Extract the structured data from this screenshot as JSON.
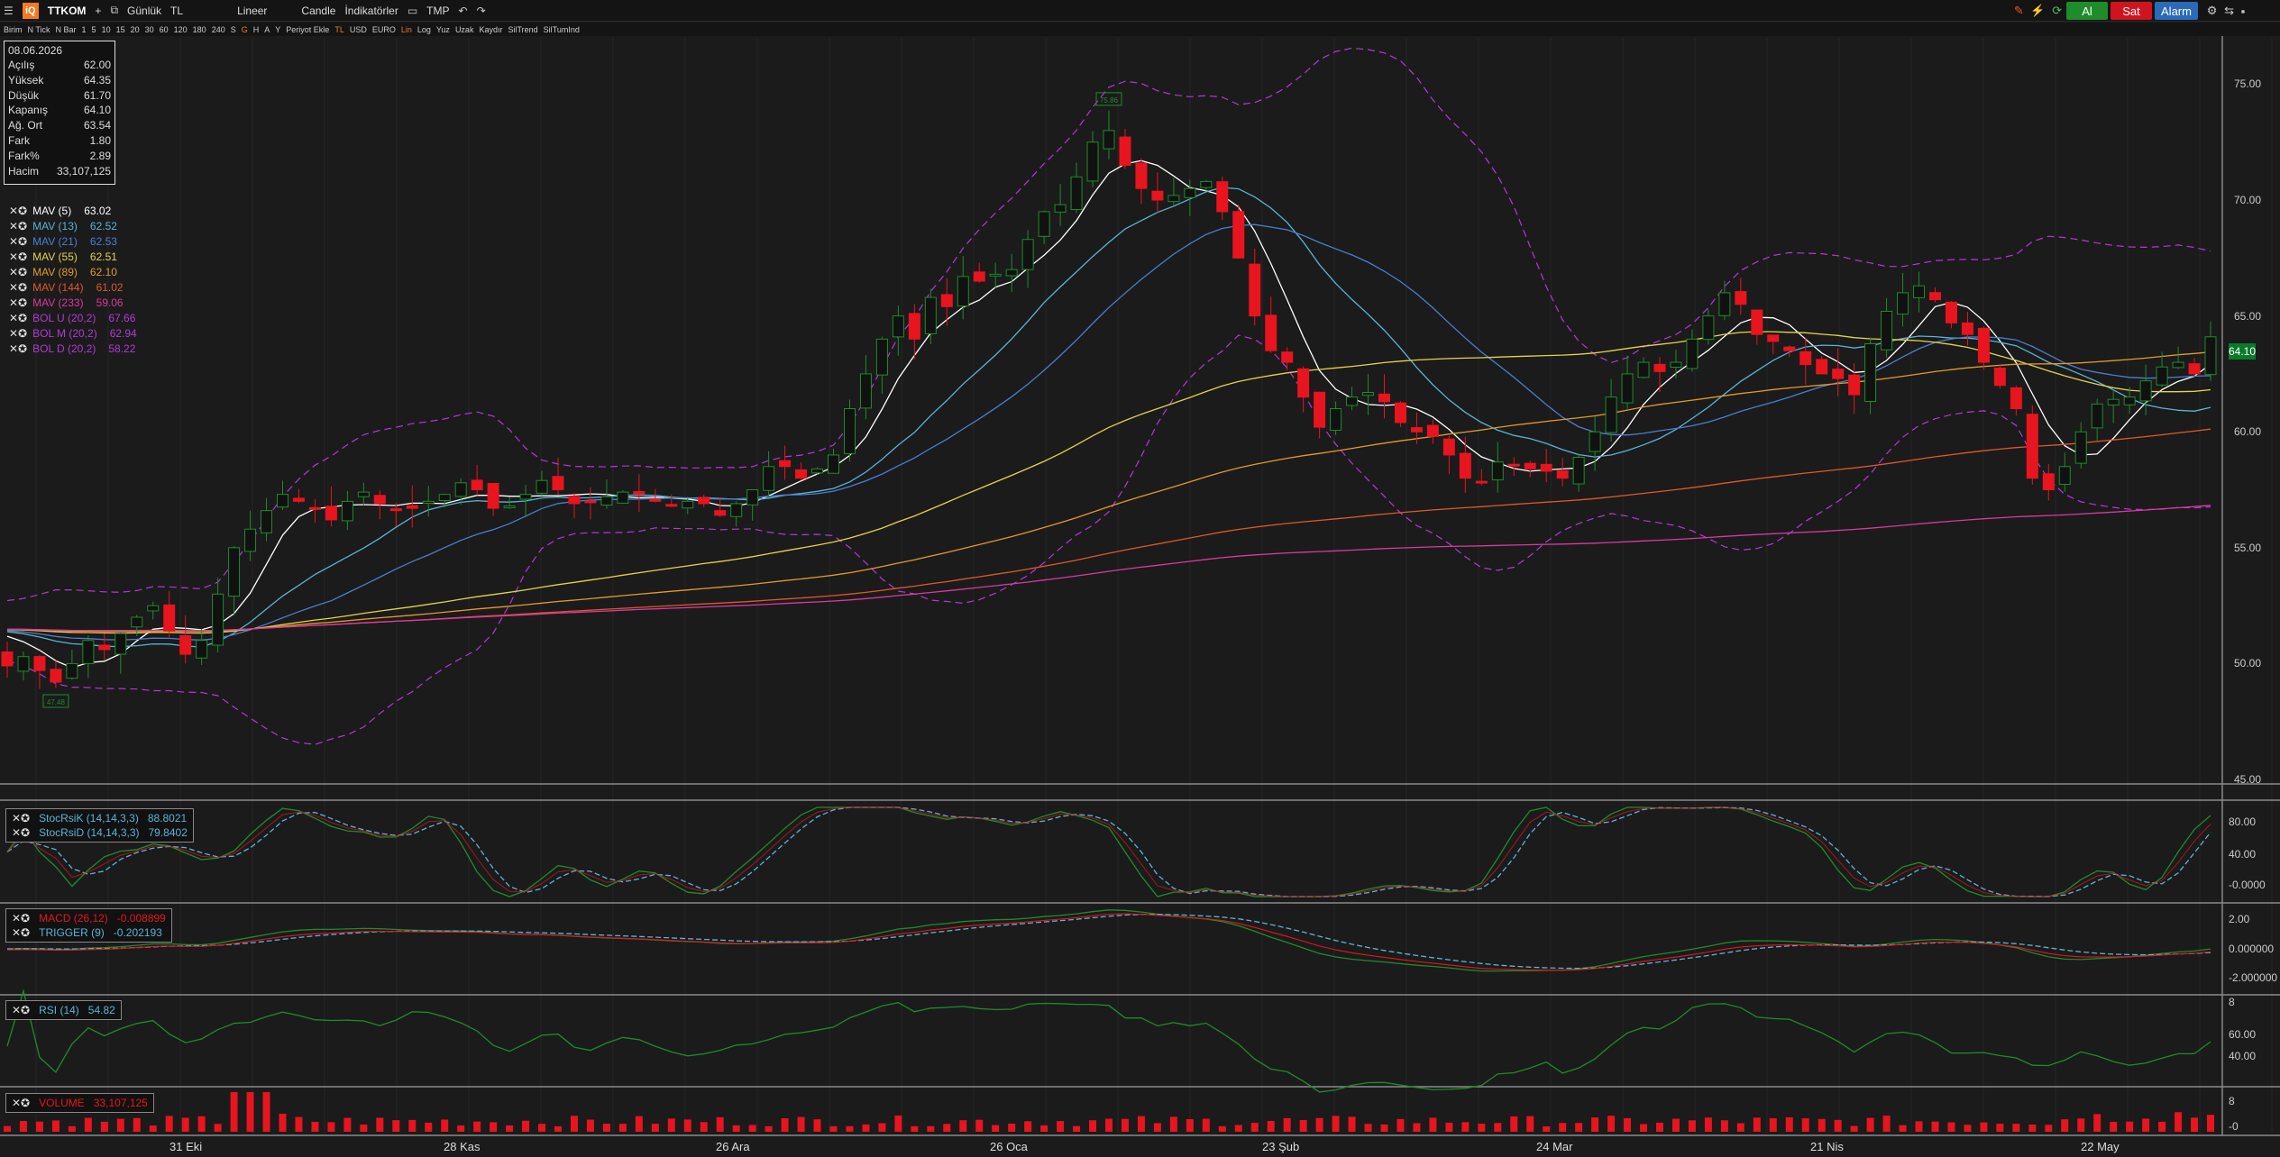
{
  "toolbar": {
    "logo": "iQ",
    "symbol": "TTKOM",
    "add": "+",
    "period": "Günlük",
    "currency": "TL",
    "scale": "Lineer",
    "chart_type": "Candle",
    "indicators": "İndikatörler",
    "template": "TMP",
    "buy_label": "Al",
    "sell_label": "Sat",
    "alarm_label": "Alarm"
  },
  "toolbar2": {
    "items": [
      "Birim",
      "N Tick",
      "N Bar",
      "1",
      "5",
      "10",
      "15",
      "20",
      "30",
      "60",
      "120",
      "180",
      "240",
      "S",
      "G",
      "H",
      "A",
      "Y",
      "Periyot Ekle",
      "TL",
      "USD",
      "EURO",
      "Lin",
      "Log",
      "Yuz",
      "Uzak",
      "Kaydır",
      "SilTrend",
      "SilTumInd"
    ]
  },
  "ohlc_box": {
    "date": "08.06.2026",
    "rows": [
      {
        "label": "Açılış",
        "value": "62.00"
      },
      {
        "label": "Yüksek",
        "value": "64.35"
      },
      {
        "label": "Düşük",
        "value": "61.70"
      },
      {
        "label": "Kapanış",
        "value": "64.10"
      },
      {
        "label": "Ağ. Ort",
        "value": "63.54"
      },
      {
        "label": "Fark",
        "value": "1.80"
      },
      {
        "label": "Fark%",
        "value": "2.89"
      },
      {
        "label": "Hacim",
        "value": "33,107,125"
      }
    ]
  },
  "indicator_legend": [
    {
      "name": "MAV (5)",
      "value": "63.02",
      "color": "#ffffff"
    },
    {
      "name": "MAV (13)",
      "value": "62.52",
      "color": "#5ab4d6"
    },
    {
      "name": "MAV (21)",
      "value": "62.53",
      "color": "#4a7fd0"
    },
    {
      "name": "MAV (55)",
      "value": "62.51",
      "color": "#e6d24a"
    },
    {
      "name": "MAV (89)",
      "value": "62.10",
      "color": "#e39a2a"
    },
    {
      "name": "MAV (144)",
      "value": "61.02",
      "color": "#e0582a"
    },
    {
      "name": "MAV (233)",
      "value": "59.06",
      "color": "#d93aa0"
    },
    {
      "name": "BOL U (20,2)",
      "value": "67.66",
      "color": "#b23ad6"
    },
    {
      "name": "BOL M (20,2)",
      "value": "62.94",
      "color": "#b23ad6"
    },
    {
      "name": "BOL D (20,2)",
      "value": "58.22",
      "color": "#b23ad6"
    }
  ],
  "last_price": "64.10",
  "annotations": {
    "high_marker": "75.86",
    "low_marker": "47.48"
  },
  "colors": {
    "up": "#1e8c2a",
    "down": "#e8141e",
    "background": "#1b1b1b"
  },
  "price_axis": {
    "ticks": [
      "75.00",
      "70.00",
      "65.00",
      "60.00",
      "55.00",
      "50.00",
      "45.00"
    ]
  },
  "date_axis": {
    "labels": [
      "31 Eki",
      "28 Kas",
      "26 Ara",
      "26 Oca",
      "23 Şub",
      "24 Mar",
      "21 Nis",
      "22 May"
    ]
  },
  "panels": {
    "stoch": {
      "legend": [
        {
          "name": "StocRsiK (14,14,3,3)",
          "value": "88.8021",
          "color": "#5ab4d6"
        },
        {
          "name": "StocRsiD (14,14,3,3)",
          "value": "79.8402",
          "color": "#5ab4d6"
        }
      ],
      "ticks": [
        "80.00",
        "40.00",
        "-0.0000"
      ]
    },
    "macd": {
      "legend": [
        {
          "name": "MACD (26,12)",
          "value": "-0.008899",
          "color": "#e8141e"
        },
        {
          "name": "TRIGGER (9)",
          "value": "-0.202193",
          "color": "#5ab4d6"
        }
      ],
      "ticks": [
        "2.00",
        "0.000000",
        "-2.000000"
      ]
    },
    "rsi": {
      "legend": [
        {
          "name": "RSI (14)",
          "value": "54.82",
          "color": "#5ab4d6"
        }
      ],
      "ticks": [
        "8",
        "60.00",
        "40.00"
      ]
    },
    "volume": {
      "legend": [
        {
          "name": "VOLUME",
          "value": "33,107,125",
          "color": "#e8141e"
        }
      ],
      "ticks": [
        "8",
        "-0"
      ]
    }
  },
  "chart_data": {
    "type": "candlestick",
    "closes": [
      49.9,
      50.3,
      49.7,
      49.2,
      50.0,
      51.0,
      50.6,
      51.3,
      52.0,
      52.5,
      51.4,
      50.4,
      51.0,
      53.0,
      55.0,
      55.8,
      56.6,
      57.3,
      57.0,
      56.7,
      56.2,
      57.0,
      57.4,
      56.9,
      56.6,
      56.7,
      57.0,
      57.3,
      57.8,
      57.5,
      56.7,
      56.8,
      57.3,
      57.9,
      57.5,
      56.9,
      57.0,
      57.2,
      57.4,
      57.3,
      57.0,
      56.8,
      57.0,
      56.9,
      56.4,
      56.9,
      57.5,
      58.5,
      58.5,
      58.0,
      58.4,
      59.0,
      61.0,
      62.5,
      64.0,
      65.0,
      64.0,
      65.8,
      65.4,
      66.7,
      66.5,
      66.8,
      67.0,
      68.3,
      69.5,
      69.8,
      71.0,
      72.5,
      73.0,
      71.5,
      70.5,
      70.0,
      70.2,
      70.5,
      70.8,
      69.5,
      67.5,
      65.0,
      63.5,
      63.0,
      61.5,
      60.2,
      61.0,
      61.5,
      61.7,
      61.3,
      60.4,
      60.0,
      59.8,
      59.0,
      58.0,
      57.8,
      58.7,
      58.6,
      58.4,
      58.3,
      58.0,
      58.9,
      60.0,
      61.5,
      62.5,
      63.0,
      62.6,
      63.0,
      64.0,
      65.0,
      66.0,
      65.5,
      64.2,
      63.9,
      63.5,
      62.9,
      62.5,
      62.3,
      61.6,
      63.8,
      65.2,
      66.0,
      66.3,
      65.7,
      64.7,
      64.2,
      63.0,
      62.0,
      61.0,
      58.0,
      57.5,
      58.5,
      60.0,
      61.2,
      61.4,
      61.5,
      62.2,
      62.8,
      63.0,
      62.5,
      64.1
    ],
    "volume_bars": 136,
    "price_range": [
      45,
      77
    ]
  }
}
